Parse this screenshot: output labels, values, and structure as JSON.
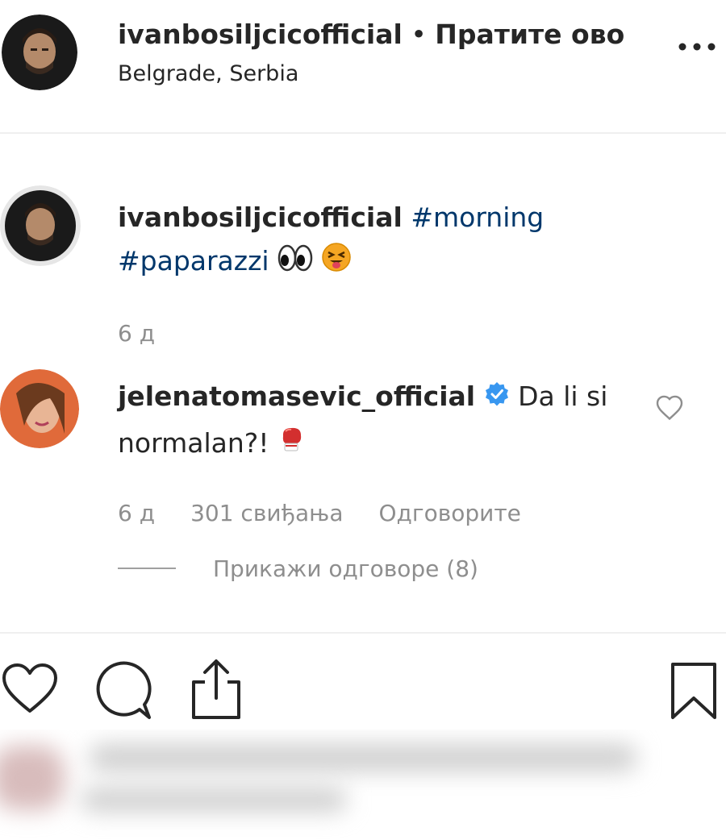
{
  "header": {
    "username": "ivanbosiljcicofficial",
    "separator": " • ",
    "follow_label": "Пратите ово",
    "location": "Belgrade, Serbia",
    "more_icon": "more-options-icon"
  },
  "caption": {
    "username": "ivanbosiljcicofficial",
    "tag1": "#morning",
    "tag2": "#paparazzi",
    "emojis": [
      "eyes-emoji",
      "squinting-tongue-emoji"
    ],
    "time": "6 д"
  },
  "comment": {
    "username": "jelenatomasevic_official",
    "verified_icon": "verified-badge-icon",
    "text": "Da li si normalan?!",
    "emoji": "boxing-glove-emoji",
    "time": "6 д",
    "likes": "301 свиђања",
    "reply_label": "Одговорите",
    "view_replies": "Прикажи одговоре (8)"
  },
  "actions": {
    "like_icon": "heart-icon",
    "comment_icon": "comment-icon",
    "share_icon": "share-icon",
    "save_icon": "bookmark-icon"
  },
  "colors": {
    "text": "#262626",
    "muted": "#8e8e8e",
    "hashtag": "#00376b",
    "verified": "#3897f0",
    "divider": "#efefef"
  }
}
